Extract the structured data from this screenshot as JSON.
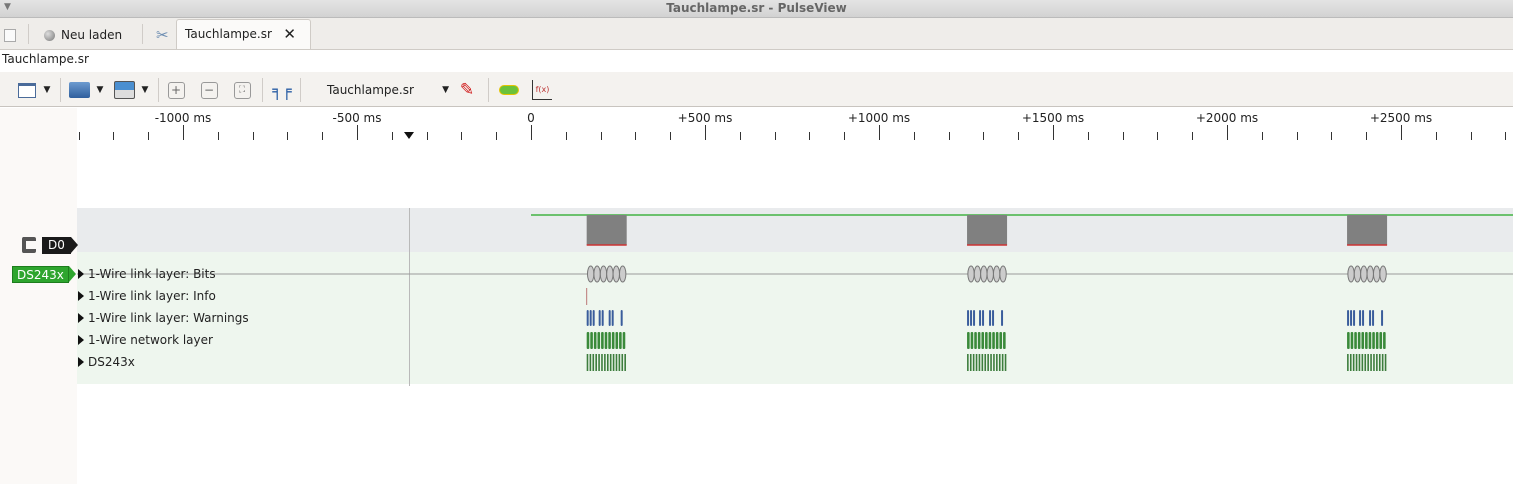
{
  "window": {
    "title": "Tauchlampe.sr - PulseView"
  },
  "tabs": [
    {
      "label": "Neu laden"
    },
    {
      "label": "Tauchlampe.sr"
    }
  ],
  "document_label": "Tauchlampe.sr",
  "toolbar": {
    "session_select": "Tauchlampe.sr"
  },
  "ruler": {
    "unit": "ms",
    "labels": [
      "-1000 ms",
      "-500 ms",
      "0",
      "+500 ms",
      "+1000 ms",
      "+1500 ms",
      "+2000 ms",
      "+2500 ms"
    ],
    "label_values": [
      -1000,
      -500,
      0,
      500,
      1000,
      1500,
      2000,
      2500
    ],
    "marker_ms": -350
  },
  "channels": {
    "d0": "D0",
    "decoder": "DS243x"
  },
  "decoder_rows": [
    "1-Wire link layer: Bits",
    "1-Wire link layer: Info",
    "1-Wire link layer: Warnings",
    "1-Wire network layer",
    "DS243x"
  ],
  "bursts_ms": [
    [
      160,
      275
    ],
    [
      1253,
      1368
    ],
    [
      2345,
      2460
    ]
  ],
  "colors": {
    "logic": "#22a822",
    "decoder": "#2ea52e",
    "bits": "#888888",
    "warnings": "#3a5d9c",
    "network": "#3a8a3a"
  }
}
